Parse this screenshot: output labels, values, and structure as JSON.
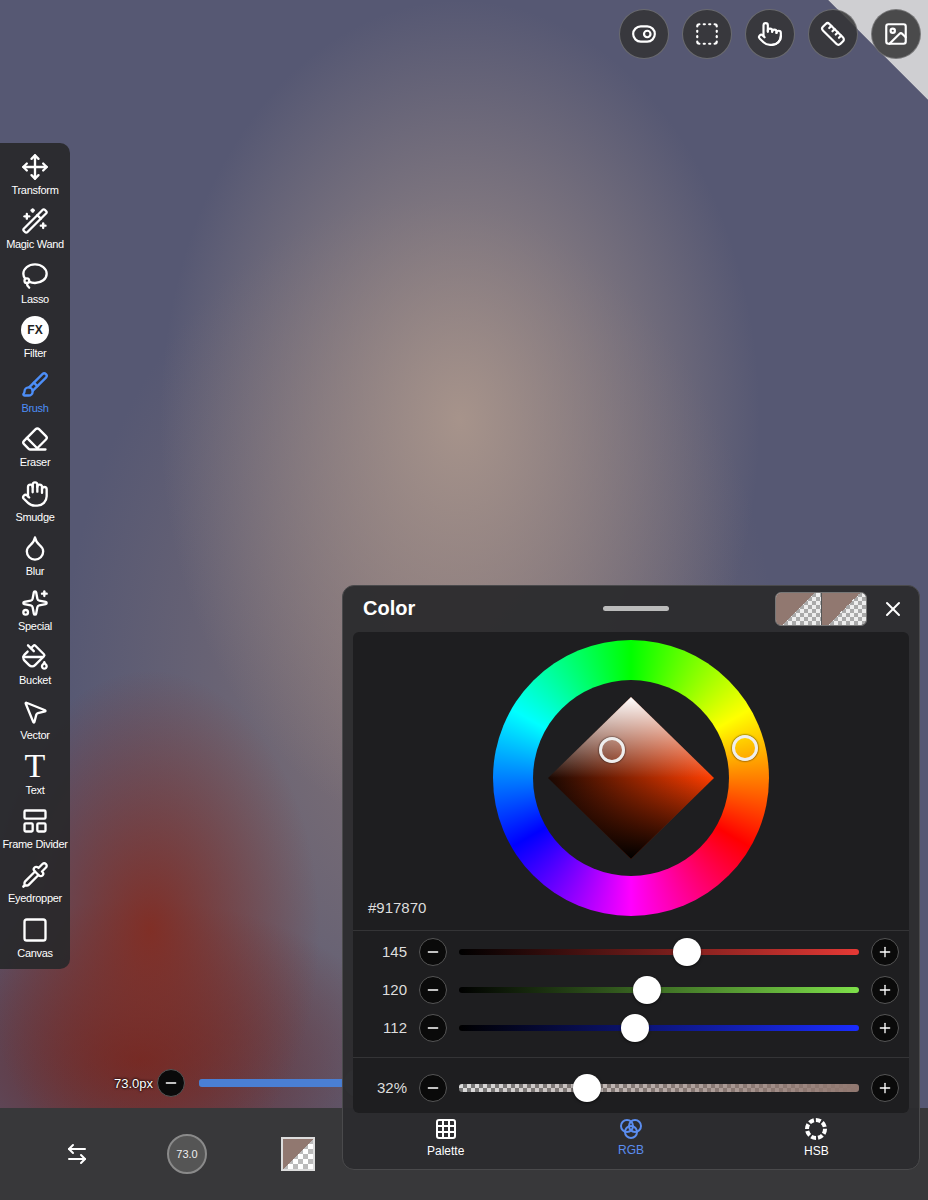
{
  "toolbar": {
    "items": [
      {
        "label": "Transform",
        "selected": false
      },
      {
        "label": "Magic Wand",
        "selected": false
      },
      {
        "label": "Lasso",
        "selected": false
      },
      {
        "label": "Filter",
        "glyph": "FX",
        "selected": false
      },
      {
        "label": "Brush",
        "selected": true
      },
      {
        "label": "Eraser",
        "selected": false
      },
      {
        "label": "Smudge",
        "selected": false
      },
      {
        "label": "Blur",
        "selected": false
      },
      {
        "label": "Special",
        "selected": false
      },
      {
        "label": "Bucket",
        "selected": false
      },
      {
        "label": "Vector",
        "selected": false
      },
      {
        "label": "Text",
        "glyph": "T",
        "selected": false
      },
      {
        "label": "Frame Divider",
        "selected": false
      },
      {
        "label": "Eyedropper",
        "selected": false
      },
      {
        "label": "Canvas",
        "selected": false
      }
    ]
  },
  "brush": {
    "size": "73.0px",
    "size_badge": "73.0",
    "level": 0.69
  },
  "color_panel": {
    "title": "Color",
    "hex": "#917870",
    "channels": [
      {
        "value": "145",
        "level": 0.569,
        "color": "#e53935"
      },
      {
        "value": "120",
        "level": 0.471,
        "color": "#7ee04a"
      },
      {
        "value": "112",
        "level": 0.439,
        "color": "#1a2cff"
      }
    ],
    "alpha": {
      "reading": "32%",
      "level": 0.32
    },
    "tabs": [
      {
        "label": "Palette",
        "selected": false
      },
      {
        "label": "RGB",
        "selected": true
      },
      {
        "label": "HSB",
        "selected": false
      }
    ]
  }
}
